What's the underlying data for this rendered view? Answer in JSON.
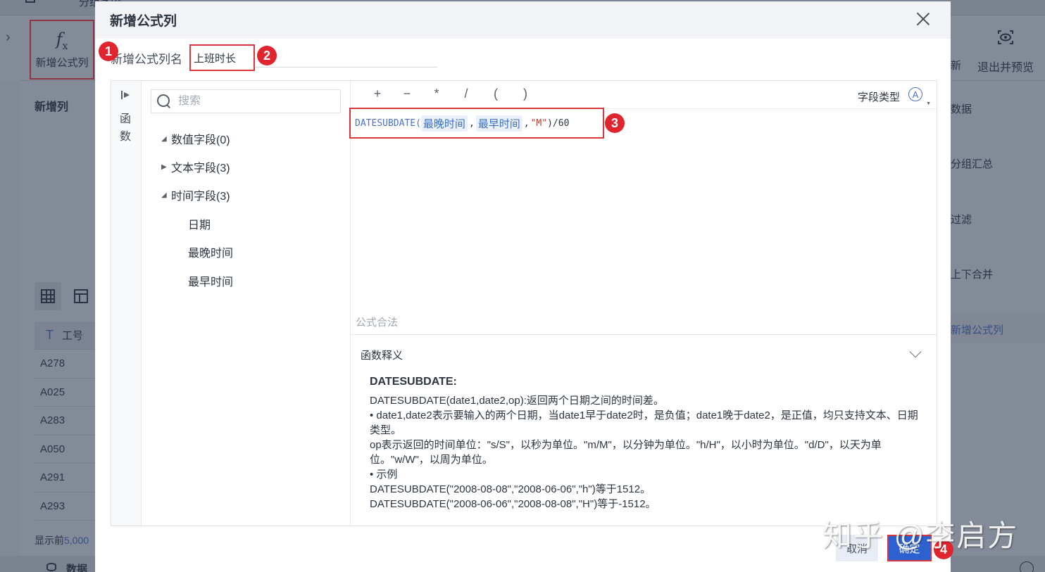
{
  "background": {
    "topbar_text": "分组字段",
    "toolbar_button_label": "新增公式列",
    "toolbar_button_icon": "fx-icon",
    "section_title": "新增列",
    "table": {
      "header_icon": "T",
      "header": "工号",
      "rows": [
        "A278",
        "A025",
        "A283",
        "A050",
        "A291",
        "A293"
      ]
    },
    "footer_note_prefix": "显示前",
    "footer_note_count": "5,000",
    "bottom_tab_label": "数据",
    "right_toolbar": {
      "refresh_label": "新",
      "preview_label": "退出并预览"
    },
    "right_menu": [
      "数据",
      "分组汇总",
      "过滤",
      "上下合并",
      "新增公式列"
    ]
  },
  "dialog": {
    "title": "新增公式列",
    "name_label": "新增公式列名",
    "name_value": "上班时长",
    "sidebar_tab_label": "函数",
    "search_placeholder": "搜索",
    "tree": [
      {
        "label": "数值字段(0)",
        "expanded": true
      },
      {
        "label": "文本字段(3)",
        "expanded": false
      },
      {
        "label": "时间字段(3)",
        "expanded": true,
        "children": [
          "日期",
          "最晚时间",
          "最早时间"
        ]
      }
    ],
    "operators": [
      "+",
      "−",
      "*",
      "/",
      "(",
      ")"
    ],
    "field_type_label": "字段类型",
    "field_type_icon": "Ⓐ",
    "formula": {
      "fn": "DATESUBDATE",
      "open": "(",
      "arg1": "最晚时间",
      "arg2": "最早时间",
      "arg3": "\"M\"",
      "tail": ")/60"
    },
    "validity_text": "公式合法",
    "description": {
      "title": "函数释义",
      "heading": "DATESUBDATE:",
      "lines": [
        "DATESUBDATE(date1,date2,op):返回两个日期之间的时间差。",
        "• date1,date2表示要输入的两个日期，当date1早于date2时，是负值；date1晚于date2，是正值，均只支持文本、日期类型。",
        "op表示返回的时间单位：\"s/S\"，以秒为单位。\"m/M\"，以分钟为单位。\"h/H\"，以小时为单位。\"d/D\"，以天为单位。\"w/W\"，以周为单位。",
        "• 示例",
        "DATESUBDATE(\"2008-08-08\",\"2008-06-06\",\"h\")等于1512。",
        "DATESUBDATE(\"2008-06-06\",\"2008-08-08\",\"H\")等于-1512。"
      ]
    },
    "cancel_label": "取消",
    "ok_label": "确定"
  },
  "annotations": [
    "1",
    "2",
    "3",
    "4"
  ],
  "watermark": "知乎 @李启方",
  "colors": {
    "primary": "#2e61d0",
    "highlight_border": "#d9363e",
    "badge": "#e0252e",
    "field_token": "#3a6fc6"
  }
}
